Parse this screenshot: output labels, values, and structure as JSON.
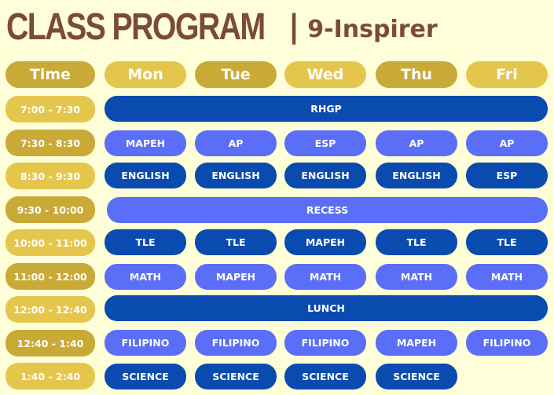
{
  "title": {
    "main": "CLASS PROGRAM",
    "separator": "|",
    "section": "9-Inspirer"
  },
  "headers": [
    "Time",
    "Mon",
    "Tue",
    "Wed",
    "Thu",
    "Fri"
  ],
  "times": [
    "7:00 - 7:30",
    "7:30 - 8:30",
    "8:30 - 9:30",
    "9:30 - 10:00",
    "10:00 - 11:00",
    "11:00 - 12:00",
    "12:00 - 12:40",
    "12:40 - 1:40",
    "1:40 - 2:40"
  ],
  "rows": [
    {
      "span": "RHGP"
    },
    {
      "cells": [
        "MAPEH",
        "AP",
        "ESP",
        "AP",
        "AP"
      ]
    },
    {
      "cells": [
        "ENGLISH",
        "ENGLISH",
        "ENGLISH",
        "ENGLISH",
        "ESP"
      ]
    },
    {
      "span": "RECESS"
    },
    {
      "cells": [
        "TLE",
        "TLE",
        "MAPEH",
        "TLE",
        "TLE"
      ]
    },
    {
      "cells": [
        "MATH",
        "MAPEH",
        "MATH",
        "MATH",
        "MATH"
      ]
    },
    {
      "span": "LUNCH"
    },
    {
      "cells": [
        "FILIPINO",
        "FILIPINO",
        "FILIPINO",
        "MAPEH",
        "FILIPINO"
      ]
    },
    {
      "cells": [
        "SCIENCE",
        "SCIENCE",
        "SCIENCE",
        "SCIENCE",
        ""
      ]
    }
  ],
  "colors": {
    "background": "#fefed8",
    "title": "#7b4a3a",
    "gold_dark": "#c9aa37",
    "gold_light": "#e5c64c",
    "blue_light": "#5b6ef7",
    "blue_dark": "#0a4bb0"
  }
}
